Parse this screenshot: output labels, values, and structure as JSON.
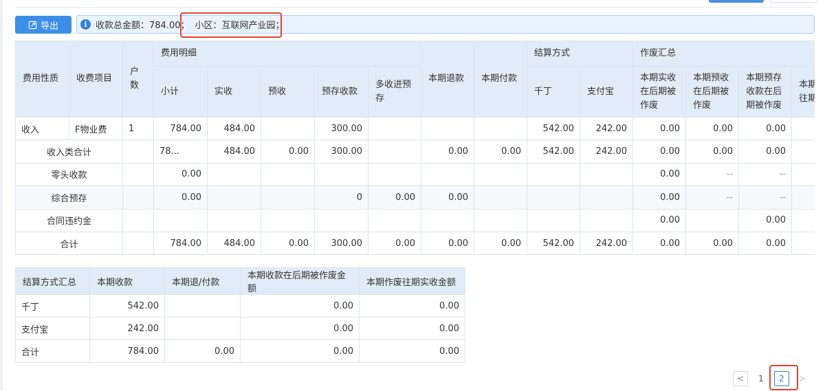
{
  "toolbar": {
    "export_label": "导出"
  },
  "info": {
    "total": "收款总金额：784.00；",
    "community": "小区：互联网产业园；"
  },
  "main_table": {
    "headers": {
      "fee_type": "费用性质",
      "item": "收费项目",
      "households": "户数",
      "detail_group": "费用明细",
      "subtotal": "小计",
      "actual": "实收",
      "advance": "预收",
      "prestore": "预存收款",
      "overpay": "多收进预存",
      "refund": "本期退款",
      "payment": "本期付款",
      "settle_group": "结算方式",
      "qianding": "千丁",
      "alipay": "支付宝",
      "void_group": "作废汇总",
      "void_actual": "本期实收在后期被作废",
      "void_advance": "本期预收在后期被作废",
      "void_prestore": "本期预存收款在后期被作废",
      "void_past": "本期往期"
    },
    "rows": [
      [
        "收入",
        "F物业费",
        "1",
        "784.00",
        "484.00",
        "",
        "300.00",
        "",
        "",
        "",
        "542.00",
        "242.00",
        "0.00",
        "0.00",
        "0.00",
        ""
      ],
      [
        "收入类合计",
        "",
        "78...",
        "484.00",
        "0.00",
        "300.00",
        "",
        "0.00",
        "0.00",
        "542.00",
        "242.00",
        "0.00",
        "0.00",
        "0.00",
        ""
      ],
      [
        "零头收款",
        "",
        "0.00",
        "",
        "",
        "",
        "",
        "",
        "",
        "",
        "",
        "0.00",
        "--",
        "--",
        ""
      ],
      [
        "综合预存",
        "",
        "0.00",
        "",
        "",
        "0",
        "0.00",
        "0.00",
        "",
        "",
        "",
        "0.00",
        "--",
        "--",
        ""
      ],
      [
        "合同违约金",
        "",
        "",
        "",
        "",
        "",
        "",
        "",
        "",
        "",
        "",
        "0.00",
        "",
        "0.00",
        ""
      ],
      [
        "合计",
        "",
        "784.00",
        "484.00",
        "0.00",
        "300.00",
        "0.00",
        "0.00",
        "0.00",
        "542.00",
        "242.00",
        "0.00",
        "0.00",
        "0.00",
        ""
      ]
    ]
  },
  "summary_table": {
    "headers": [
      "结算方式汇总",
      "本期收款",
      "本期退/付款",
      "本期收款在后期被作废金额",
      "本期作废往期实收金额"
    ],
    "rows": [
      [
        "千丁",
        "542.00",
        "",
        "0.00",
        "0.00"
      ],
      [
        "支付宝",
        "242.00",
        "",
        "0.00",
        "0.00"
      ],
      [
        "合计",
        "784.00",
        "0.00",
        "0.00",
        "0.00"
      ]
    ]
  },
  "pagination": {
    "prev": "<",
    "page1": "1",
    "page2": "2",
    "next": ">",
    "current": "2"
  },
  "colors": {
    "primary": "#3d8ee9",
    "header_bg": "#e2ecf8",
    "highlight": "#e0442f"
  },
  "icons": {
    "export": "export-icon",
    "info": "info-icon"
  }
}
